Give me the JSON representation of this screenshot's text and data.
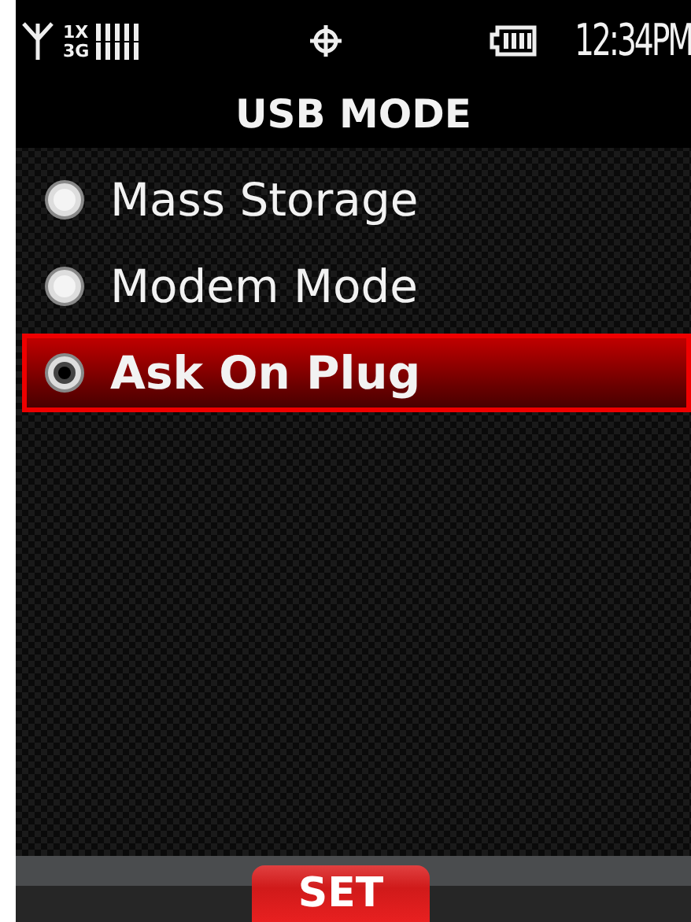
{
  "status_bar": {
    "network_top": "1X",
    "network_bottom": "3G",
    "time": "12:34PM"
  },
  "title": "USB MODE",
  "options": [
    {
      "label": "Mass Storage",
      "selected": false
    },
    {
      "label": "Modem Mode",
      "selected": false
    },
    {
      "label": "Ask On Plug",
      "selected": true
    }
  ],
  "softkey": "SET"
}
